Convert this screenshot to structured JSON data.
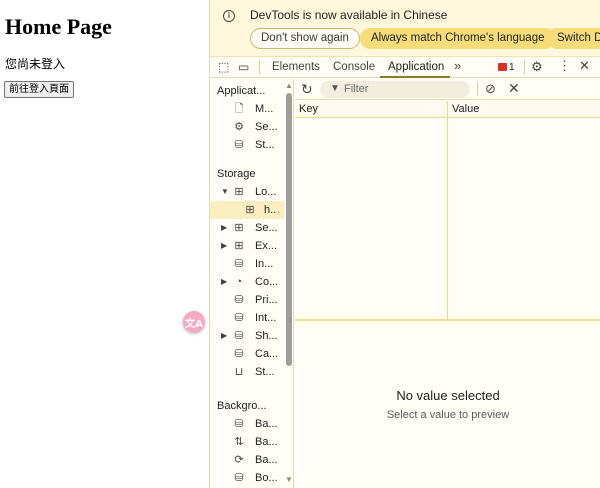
{
  "page": {
    "title": "Home Page",
    "status": "您尚未登入",
    "login_button": "前往登入頁面"
  },
  "translate_fab": {
    "label": "文A"
  },
  "infobar": {
    "message": "DevTools is now available in Chinese",
    "buttons": [
      "Don't show again",
      "Always match Chrome's language",
      "Switch De"
    ]
  },
  "toolbar": {
    "tabs": [
      "Elements",
      "Console",
      "Application"
    ],
    "more": "»",
    "active_tab": "Application",
    "issues_count": "1",
    "colors": {
      "issues": "#d93025",
      "accent": "#8a7a2c"
    }
  },
  "sidebar": {
    "sections": {
      "application": "Applicat...",
      "storage": "Storage",
      "background": "Backgro..."
    },
    "application_items": [
      "M...",
      "Se...",
      "St..."
    ],
    "storage_items": [
      "Lo...",
      "h..",
      "Se...",
      "Ex...",
      "In...",
      "Co...",
      "Pri...",
      "Int...",
      "Sh...",
      "Ca...",
      "St..."
    ],
    "background_items": [
      "Ba...",
      "Ba...",
      "Ba...",
      "Bo..."
    ]
  },
  "filter": {
    "placeholder": "Filter"
  },
  "table": {
    "columns": [
      "Key",
      "Value"
    ]
  },
  "preview": {
    "title": "No value selected",
    "subtitle": "Select a value to preview"
  }
}
